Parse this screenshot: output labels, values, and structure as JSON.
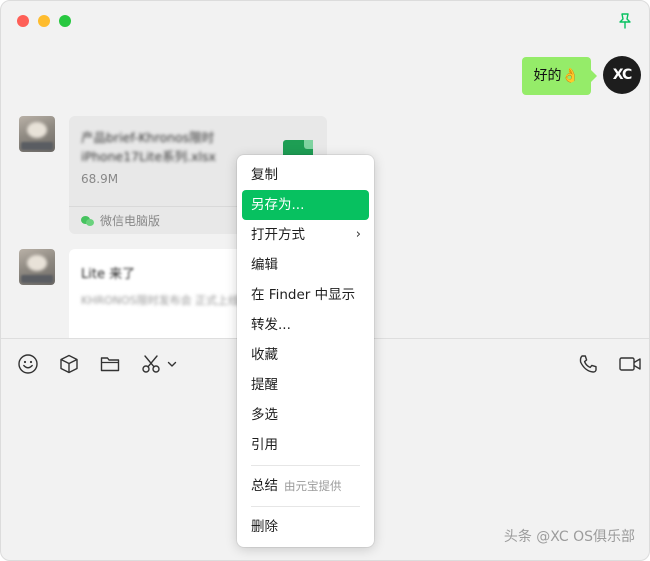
{
  "chat": {
    "outgoing_message": "好的👌",
    "self_avatar_text": "XC",
    "file_message": {
      "file_name": "产品brief-Khronos限时iPhone17Lite系列.xlsx",
      "file_size": "68.9M",
      "source": "微信电脑版"
    },
    "link_message": {
      "title": "Lite 来了",
      "description": "KHRONOS限时发布会 正式上线!"
    }
  },
  "context_menu": {
    "items": [
      {
        "label": "复制"
      },
      {
        "label": "另存为..."
      },
      {
        "label": "打开方式"
      },
      {
        "label": "编辑"
      },
      {
        "label": "在 Finder 中显示"
      },
      {
        "label": "转发..."
      },
      {
        "label": "收藏"
      },
      {
        "label": "提醒"
      },
      {
        "label": "多选"
      },
      {
        "label": "引用"
      }
    ],
    "summary": {
      "label": "总结",
      "hint": "由元宝提供"
    },
    "delete": {
      "label": "删除"
    },
    "submenu_chevron": "›"
  },
  "watermark": "头条 @XC OS俱乐部",
  "colors": {
    "accent_green": "#07c160",
    "bubble_green": "#95ec69",
    "window_bg": "#f2f2f2"
  },
  "icons": [
    "pin-icon",
    "emoji-icon",
    "sticker-box-icon",
    "folder-icon",
    "scissors-icon",
    "chevron-down-icon",
    "phone-icon",
    "video-call-icon"
  ]
}
